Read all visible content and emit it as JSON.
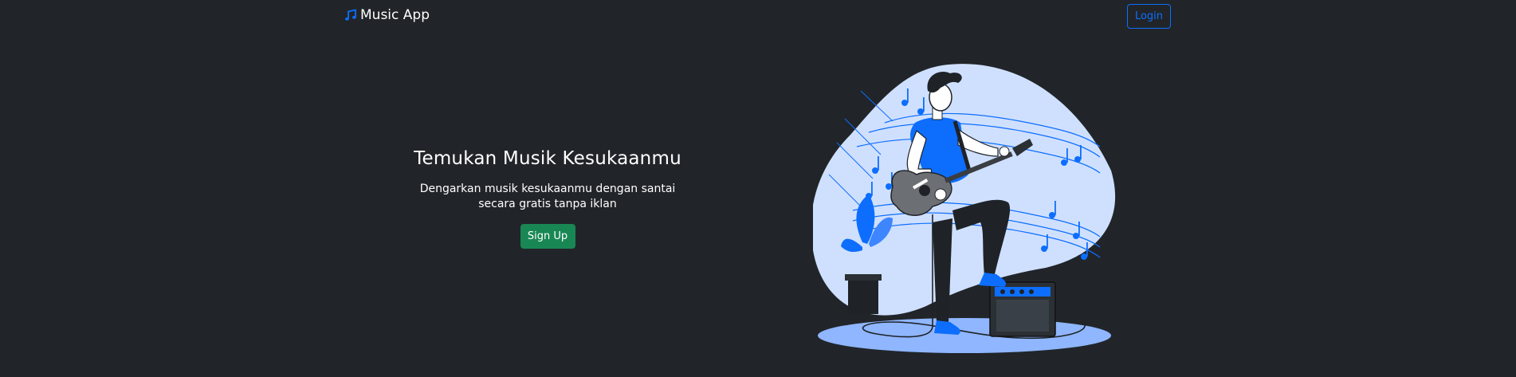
{
  "navbar": {
    "brand": "Music App",
    "brand_icon": "music-note-icon",
    "login_label": "Login"
  },
  "hero": {
    "title": "Temukan Musik Kesukaanmu",
    "subtitle": "Dengarkan musik kesukaanmu dengan santai secara gratis tanpa iklan",
    "signup_label": "Sign Up",
    "illustration": "guitarist-illustration"
  },
  "colors": {
    "background": "#212529",
    "primary": "#0d6efd",
    "success": "#198754",
    "blob": "#cfe0ff",
    "text": "#ffffff"
  }
}
